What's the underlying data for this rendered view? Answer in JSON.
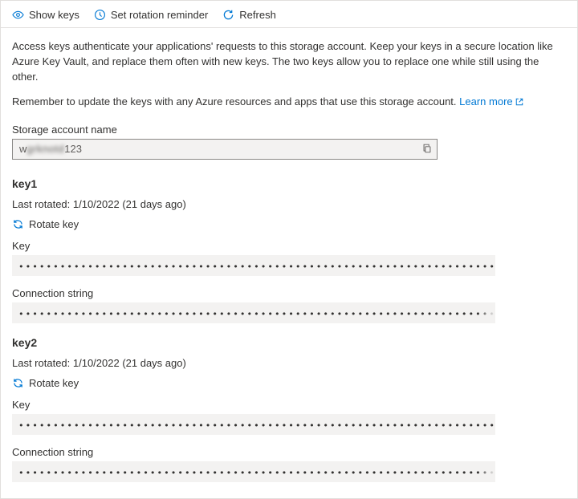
{
  "toolbar": {
    "show_keys": "Show keys",
    "set_rotation": "Set rotation reminder",
    "refresh": "Refresh"
  },
  "description1": "Access keys authenticate your applications' requests to this storage account. Keep your keys in a secure location like Azure Key Vault, and replace them often with new keys. The two keys allow you to replace one while still using the other.",
  "description2_prefix": "Remember to update the keys with any Azure resources and apps that use this storage account. ",
  "learn_more": "Learn more",
  "storage_account_label": "Storage account name",
  "storage_account_prefix": "w",
  "storage_account_blur": "grknotd",
  "storage_account_suffix": "123",
  "keys": [
    {
      "title": "key1",
      "last_rotated_label": "Last rotated: 1/10/2022 (21 days ago)",
      "rotate_label": "Rotate key",
      "key_label": "Key",
      "key_value": "••••••••••••••••••••••••••••••••••••••••••••••••••••••••••••••••••••••••••••••••••••••",
      "conn_label": "Connection string",
      "conn_value": "•••••••••••••••••••••••••••••••••••••••••••••••••••••••••••••••••••••••••••••••••••••••••••••••••••••••"
    },
    {
      "title": "key2",
      "last_rotated_label": "Last rotated: 1/10/2022 (21 days ago)",
      "rotate_label": "Rotate key",
      "key_label": "Key",
      "key_value": "••••••••••••••••••••••••••••••••••••••••••••••••••••••••••••••••••••••••••••••••••••••",
      "conn_label": "Connection string",
      "conn_value": "•••••••••••••••••••••••••••••••••••••••••••••••••••••••••••••••••••••••••••••••••••••••••••••••••••••••"
    }
  ]
}
